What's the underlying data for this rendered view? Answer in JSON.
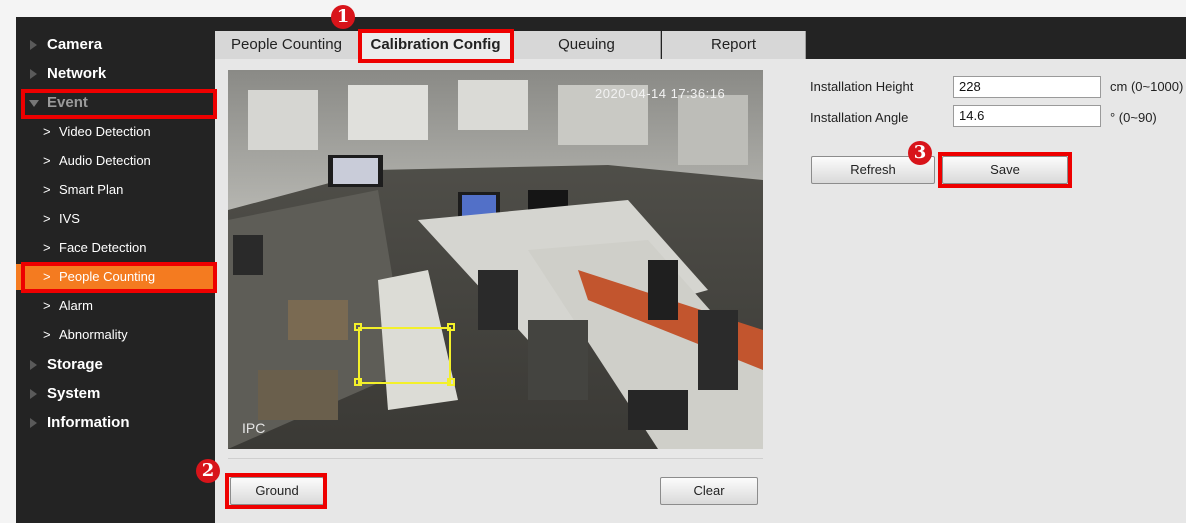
{
  "sidebar": {
    "items": [
      {
        "label": "Camera"
      },
      {
        "label": "Network"
      },
      {
        "label": "Event"
      }
    ],
    "event_subitems": [
      {
        "label": "Video Detection"
      },
      {
        "label": "Audio Detection"
      },
      {
        "label": "Smart Plan"
      },
      {
        "label": "IVS"
      },
      {
        "label": "Face Detection"
      },
      {
        "label": "People Counting"
      },
      {
        "label": "Alarm"
      },
      {
        "label": "Abnormality"
      }
    ],
    "bottom_items": [
      {
        "label": "Storage"
      },
      {
        "label": "System"
      },
      {
        "label": "Information"
      }
    ],
    "active_subitem": "People Counting"
  },
  "tabs": [
    {
      "label": "People Counting"
    },
    {
      "label": "Calibration Config"
    },
    {
      "label": "Queuing"
    },
    {
      "label": "Report"
    }
  ],
  "active_tab": "Calibration Config",
  "video": {
    "timestamp": "2020-04-14 17:36:16",
    "watermark": "IPC"
  },
  "buttons": {
    "ground": "Ground",
    "clear": "Clear",
    "refresh": "Refresh",
    "save": "Save"
  },
  "form": {
    "installation_height": {
      "label": "Installation Height",
      "value": "228",
      "unit": "cm (0~1000)"
    },
    "installation_angle": {
      "label": "Installation Angle",
      "value": "14.6",
      "unit": "° (0~90)"
    }
  },
  "annotations": {
    "step1": "1",
    "step2": "2",
    "step3": "3"
  },
  "colors": {
    "sidebar_bg": "#232323",
    "active_item": "#f47b20",
    "highlight": "#e00000",
    "roi": "#f3f02a"
  }
}
